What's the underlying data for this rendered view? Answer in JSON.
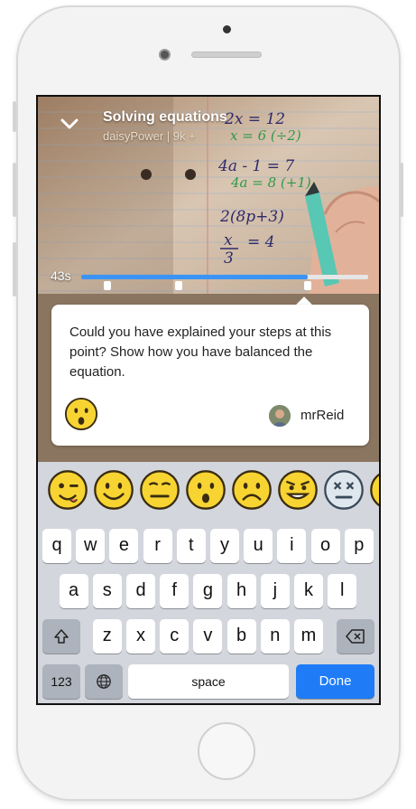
{
  "video": {
    "title": "Solving equations",
    "subtitle": "daisyPower | 9k +",
    "time": "43s",
    "progress": 0.79,
    "marker_positions": [
      0.09,
      0.34,
      0.79
    ],
    "whiteboard_lines": [
      "2x = 12",
      "x = 6 (÷2)",
      "4a - 1 = 7",
      "4a = 8 (+1)",
      "2(8p+3)",
      "x",
      "3",
      "= 4"
    ]
  },
  "comment": {
    "text": "Could you have explained your steps at this point? Show how you have balanced the equation.",
    "reaction": "surprised-emoji",
    "author": "mrReid"
  },
  "emoji_bar": {
    "items": [
      "winking-emoji",
      "smiling-emoji",
      "neutral-emoji",
      "surprised-emoji",
      "sad-emoji",
      "mischievous-emoji",
      "dizzy-emoji",
      "partial-emoji"
    ]
  },
  "keyboard": {
    "row1": [
      "q",
      "w",
      "e",
      "r",
      "t",
      "y",
      "u",
      "i",
      "o",
      "p"
    ],
    "row2": [
      "a",
      "s",
      "d",
      "f",
      "g",
      "h",
      "j",
      "k",
      "l"
    ],
    "row3": [
      "z",
      "x",
      "c",
      "v",
      "b",
      "n",
      "m"
    ],
    "numbers_label": "123",
    "space_label": "space",
    "done_label": "Done"
  },
  "colors": {
    "accent": "#3b94f4",
    "done": "#1f7cf6",
    "keyboard_bg": "#d3d6dc",
    "emoji_yellow": "#f7d432"
  }
}
